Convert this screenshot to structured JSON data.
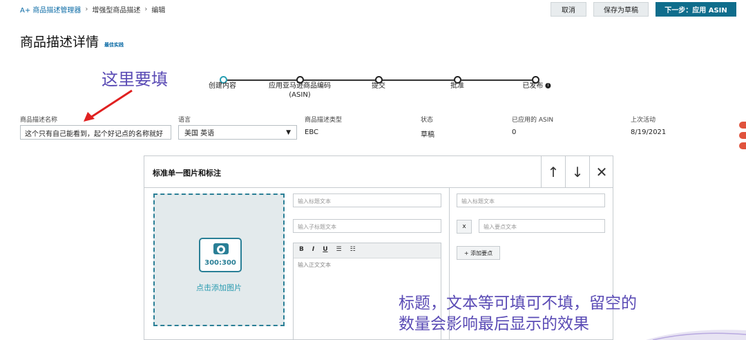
{
  "breadcrumb": {
    "item1": "A+ 商品描述管理器",
    "sep": "›",
    "item2": "增强型商品描述",
    "item3": "编辑"
  },
  "top_actions": {
    "cancel": "取消",
    "save_draft": "保存为草稿",
    "next": "下一步：应用 ASIN"
  },
  "page": {
    "title": "商品描述详情",
    "best_practice": "最佳实践"
  },
  "annotations": {
    "top": "这里要填",
    "bottom_line1": "标题，文本等可填可不填，留空的",
    "bottom_line2": "数量会影响最后显示的效果"
  },
  "progress": {
    "steps": [
      "创建内容",
      "应用亚马逊商品编码",
      "提交",
      "批准",
      "已发布"
    ],
    "step2_sub": "(ASIN)",
    "info": "i"
  },
  "fields": {
    "name_label": "商品描述名称",
    "name_value": "这个只有自己能看到，起个好记点的名称就好",
    "language_label": "语言",
    "language_value": "美国 英语",
    "type_label": "商品描述类型",
    "type_value": "EBC",
    "status_label": "状态",
    "status_value": "草稿",
    "asin_label": "已应用的 ASIN",
    "asin_value": "0",
    "activity_label": "上次活动",
    "activity_value": "8/19/2021"
  },
  "module": {
    "title": "标准单一图片和标注",
    "up": "↑",
    "down": "↓",
    "close": "✕",
    "image_size": "300:300",
    "image_cta": "点击添加图片",
    "heading_placeholder": "输入标题文本",
    "subheading_placeholder": "输入子标题文本",
    "body_placeholder": "输入正文文本",
    "right_heading_placeholder": "输入标题文本",
    "bullet_placeholder": "输入要点文本",
    "remove_bullet": "x",
    "add_bullet": "+ 添加要点",
    "toolbar": {
      "bold": "B",
      "italic": "I",
      "underline": "U",
      "ul": "☰",
      "ol": "☷"
    }
  },
  "colors": {
    "primary": "#0f6d8c",
    "annotation": "#5a4bb5",
    "arrow": "#e02020",
    "teal": "#2a7f96"
  }
}
